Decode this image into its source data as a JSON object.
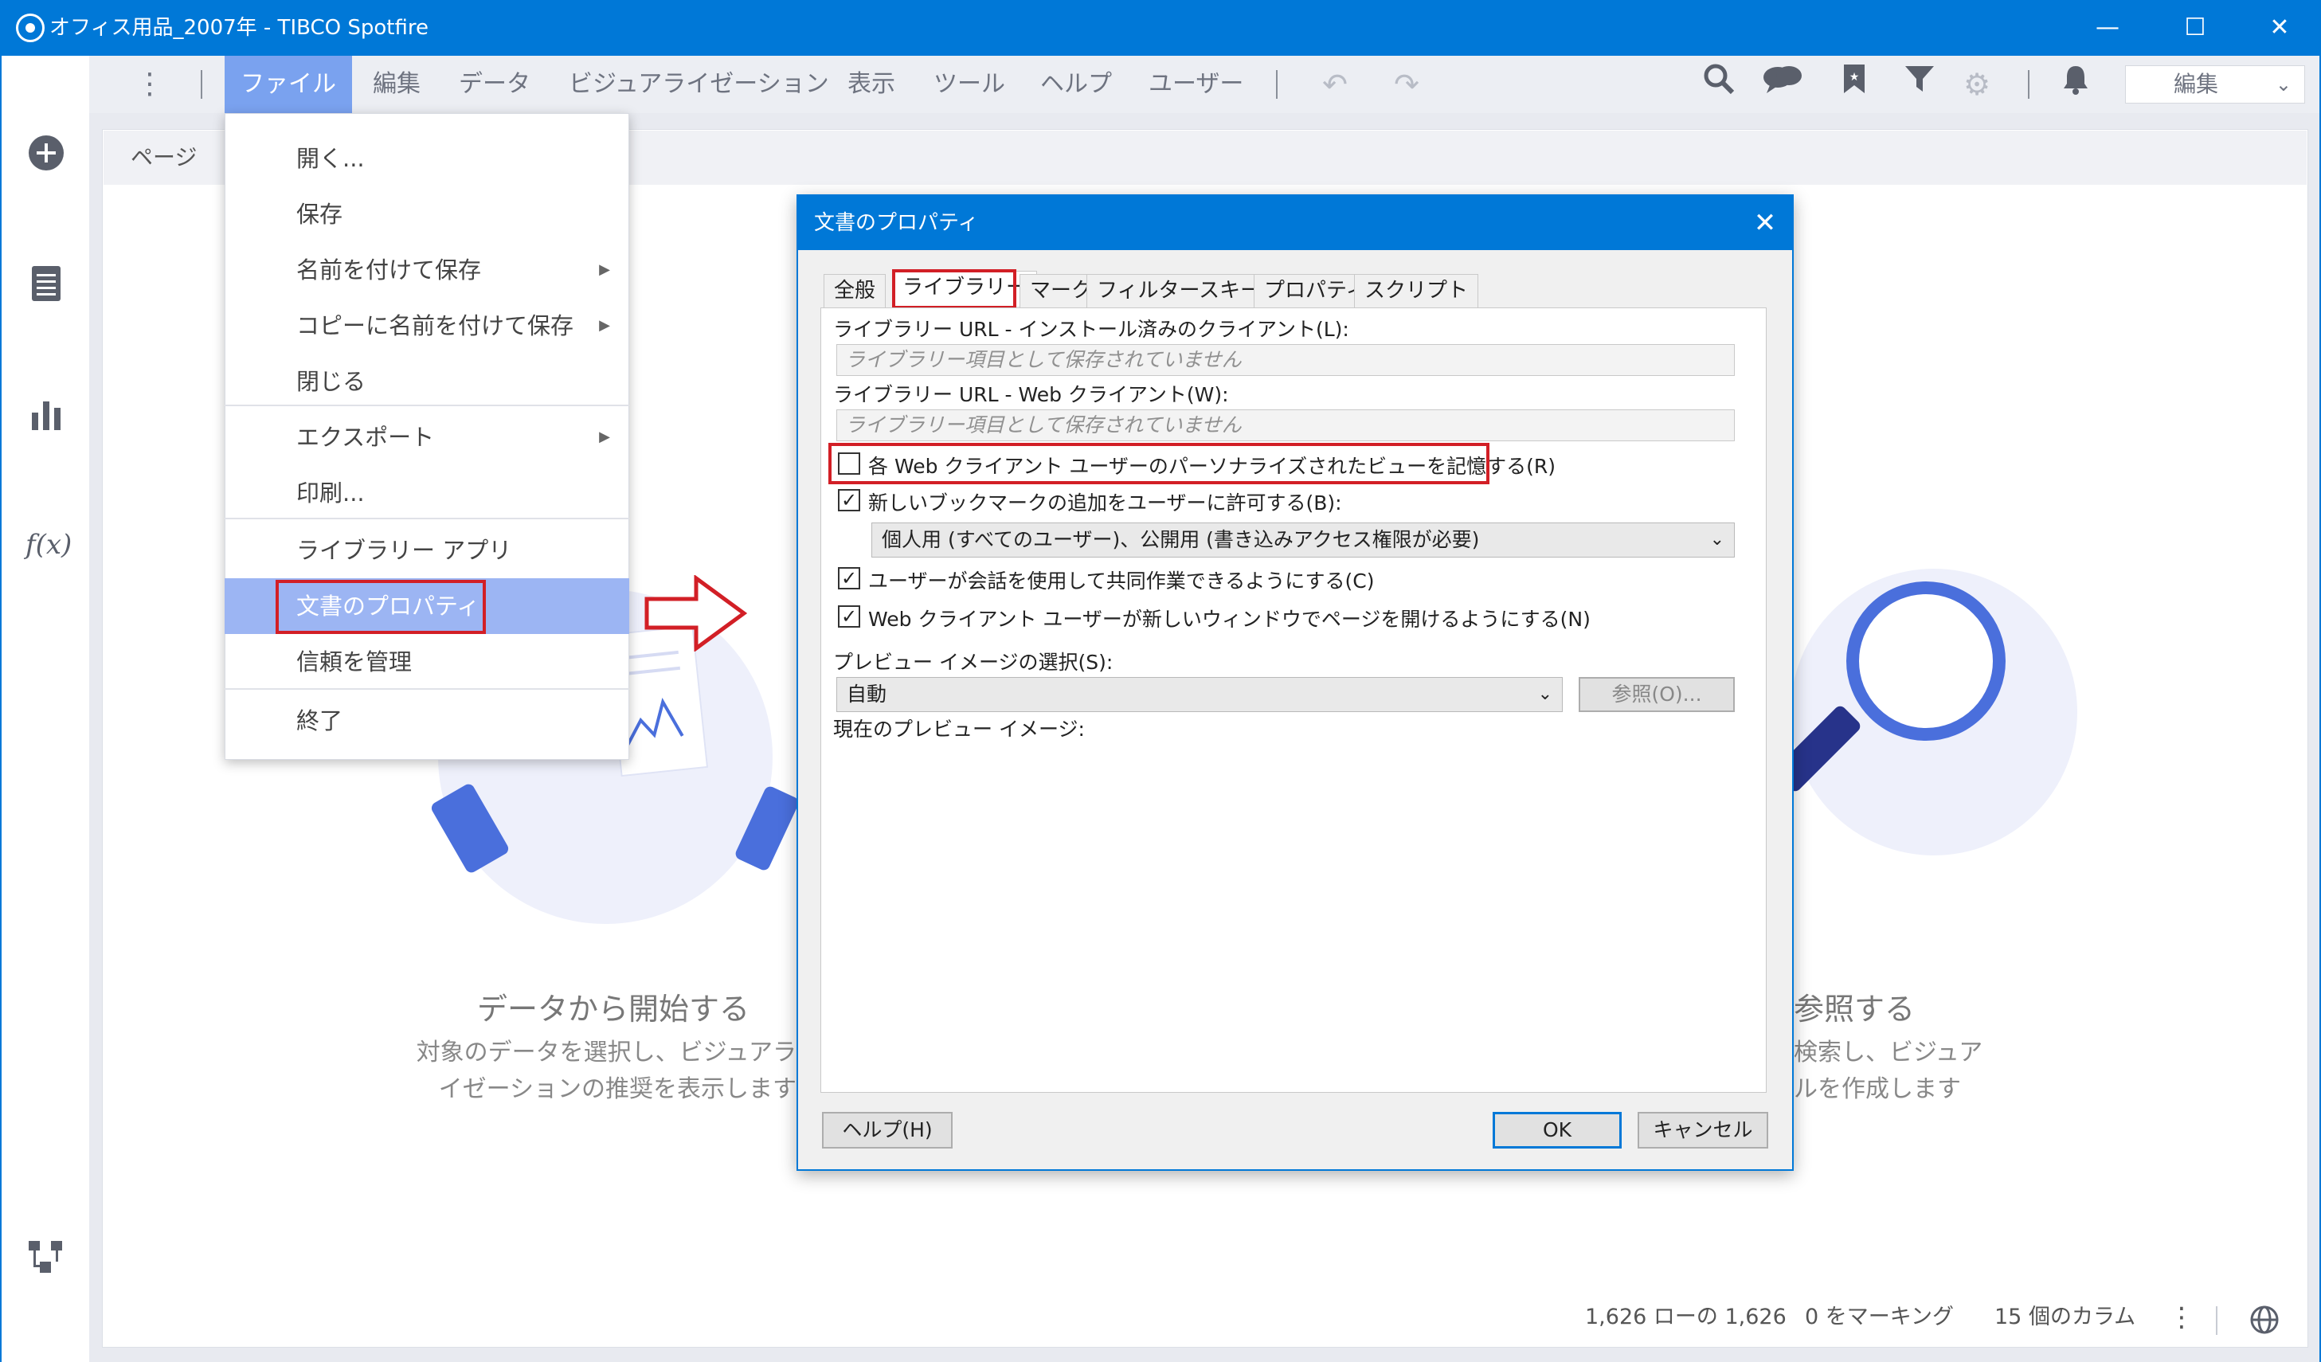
{
  "window": {
    "title": "オフィス用品_2007年 - TIBCO Spotfire",
    "minimize": "—",
    "maximize": "☐",
    "close": "✕"
  },
  "menubar": {
    "overflow": "⋮",
    "items": [
      "ファイル",
      "編集",
      "データ",
      "ビジュアライゼーション",
      "表示",
      "ツール",
      "ヘルプ",
      "ユーザー"
    ],
    "mode_select": "編集"
  },
  "page_tab": {
    "label": "ページ",
    "chevron": "›"
  },
  "file_menu": {
    "items": [
      {
        "label": "開く...",
        "submenu": false
      },
      {
        "label": "保存",
        "submenu": false
      },
      {
        "label": "名前を付けて保存",
        "submenu": true
      },
      {
        "label": "コピーに名前を付けて保存",
        "submenu": true
      },
      {
        "label": "閉じる",
        "submenu": false
      },
      {
        "label": "エクスポート",
        "submenu": true
      },
      {
        "label": "印刷...",
        "submenu": false
      },
      {
        "label": "ライブラリー アプリ",
        "submenu": false
      },
      {
        "label": "文書のプロパティ",
        "submenu": false
      },
      {
        "label": "信頼を管理",
        "submenu": false
      },
      {
        "label": "終了",
        "submenu": false
      }
    ],
    "highlighted_index": 8,
    "submenu_arrow": "▶"
  },
  "start_panel": {
    "data_title": "データから開始する",
    "data_desc_1": "対象のデータを選択し、ビジュアラ",
    "data_desc_2": "イゼーションの推奨を表示します",
    "browse_title": "参照する",
    "browse_desc_1": "検索し、ビジュア",
    "browse_desc_2": "ルを作成します"
  },
  "dialog": {
    "title": "文書のプロパティ",
    "close": "✕",
    "tabs": [
      "全般",
      "ライブラリー",
      "マーク",
      "フィルタースキーム",
      "プロパティ",
      "スクリプト"
    ],
    "active_tab": 1,
    "library_url_client_label": "ライブラリー URL - インストール済みのクライアント(L):",
    "library_url_client_value": "ライブラリー項目として保存されていません",
    "library_url_web_label": "ライブラリー URL - Web クライアント(W):",
    "library_url_web_value": "ライブラリー項目として保存されていません",
    "remember_view_label": "各 Web クライアント ユーザーのパーソナライズされたビューを記憶する(R)",
    "remember_view_checked": false,
    "allow_bookmarks_label": "新しいブックマークの追加をユーザーに許可する(B):",
    "allow_bookmarks_checked": true,
    "bookmark_option": "個人用 (すべてのユーザー)、公開用 (書き込みアクセス権限が必要)",
    "collab_label": "ユーザーが会話を使用して共同作業できるようにする(C)",
    "collab_checked": true,
    "new_window_label": "Web クライアント ユーザーが新しいウィンドウでページを開けるようにする(N)",
    "new_window_checked": true,
    "preview_select_label": "プレビュー イメージの選択(S):",
    "preview_select_value": "自動",
    "browse_button": "参照(O)...",
    "current_preview_label": "現在のプレビュー イメージ:",
    "help_button": "ヘルプ(H)",
    "ok_button": "OK",
    "cancel_button": "キャンセル",
    "check_mark": "✓",
    "dropdown_chevron": "⌄"
  },
  "statusbar": {
    "rows": "1,626 ローの 1,626",
    "marking": "0 をマーキング",
    "columns": "15 個のカラム",
    "overflow": "⋮"
  },
  "colors": {
    "accent": "#0078d7",
    "menu_active": "#7aa2ef",
    "highlight_box": "#d21f26"
  }
}
